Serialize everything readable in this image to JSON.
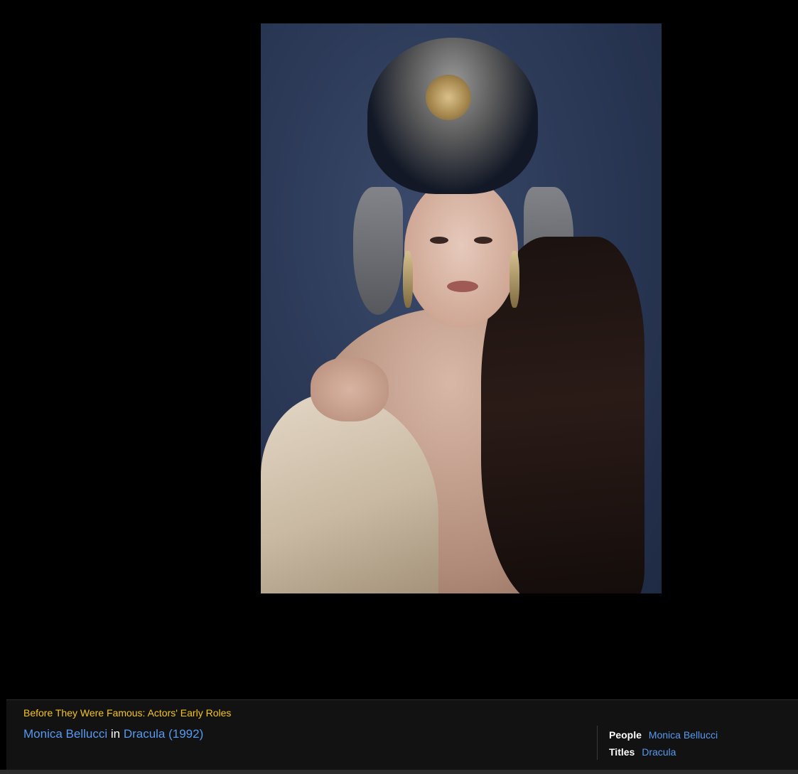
{
  "photo": {
    "alt_subject": "Monica Bellucci"
  },
  "caption": {
    "gallery_title": "Before They Were Famous: Actors' Early Roles",
    "person_name": "Monica Bellucci",
    "connector": "in",
    "title_link": "Dracula (1992)",
    "people_label": "People",
    "people_value": "Monica Bellucci",
    "titles_label": "Titles",
    "titles_value": "Dracula"
  },
  "colors": {
    "background": "#000000",
    "panel": "#121212",
    "accent_gold": "#f5c518",
    "link_blue": "#5799ef"
  }
}
